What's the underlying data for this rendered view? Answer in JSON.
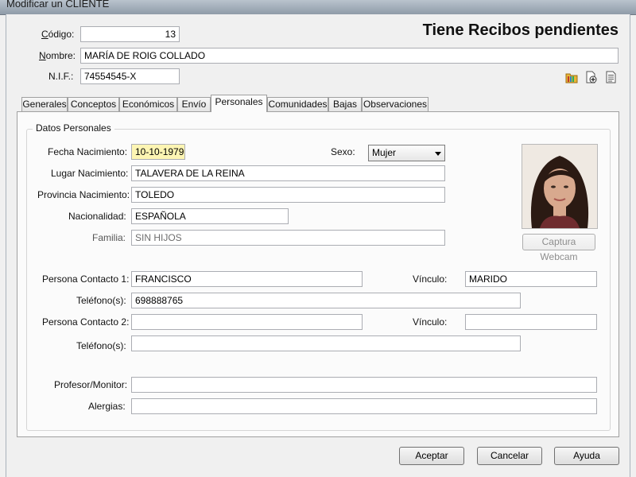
{
  "window": {
    "title": "Modificar un CLIENTE"
  },
  "header": {
    "codigo_label": "Código:",
    "codigo_value": "13",
    "nombre_label": "Nombre:",
    "nombre_value": "MARÍA DE ROIG COLLADO",
    "nif_label": "N.I.F.:",
    "nif_value": "74554545-X",
    "status_text": "Tiene Recibos pendientes"
  },
  "toolbar_icons": [
    "folder-icon",
    "add-document-icon",
    "report-icon"
  ],
  "tabs": [
    {
      "label": "Generales",
      "active": false
    },
    {
      "label": "Conceptos",
      "active": false
    },
    {
      "label": "Económicos",
      "active": false
    },
    {
      "label": "Envío",
      "active": false
    },
    {
      "label": "Personales",
      "active": true
    },
    {
      "label": "Comunidades",
      "active": false
    },
    {
      "label": "Bajas",
      "active": false
    },
    {
      "label": "Observaciones",
      "active": false
    }
  ],
  "personal": {
    "group_title": "Datos Personales",
    "fecha_label": "Fecha Nacimiento:",
    "fecha_value": "10-10-1979",
    "sexo_label": "Sexo:",
    "sexo_value": "Mujer",
    "lugar_label": "Lugar Nacimiento:",
    "lugar_value": "TALAVERA DE LA REINA",
    "provincia_label": "Provincia Nacimiento:",
    "provincia_value": "TOLEDO",
    "nacionalidad_label": "Nacionalidad:",
    "nacionalidad_value": "ESPAÑOLA",
    "familia_label": "Familia:",
    "familia_value": "SIN HIJOS",
    "webcam_button": "Captura Webcam",
    "contacto1_label": "Persona Contacto 1:",
    "contacto1_value": "FRANCISCO",
    "vinculo1_label": "Vínculo:",
    "vinculo1_value": "MARIDO",
    "telefono1_label": "Teléfono(s):",
    "telefono1_value": "698888765",
    "contacto2_label": "Persona Contacto 2:",
    "contacto2_value": "",
    "vinculo2_label": "Vínculo:",
    "vinculo2_value": "",
    "telefono2_label": "Teléfono(s):",
    "telefono2_value": "",
    "profesor_label": "Profesor/Monitor:",
    "profesor_value": "",
    "alergias_label": "Alergias:",
    "alergias_value": ""
  },
  "footer": {
    "aceptar": "Aceptar",
    "cancelar": "Cancelar",
    "ayuda": "Ayuda"
  }
}
